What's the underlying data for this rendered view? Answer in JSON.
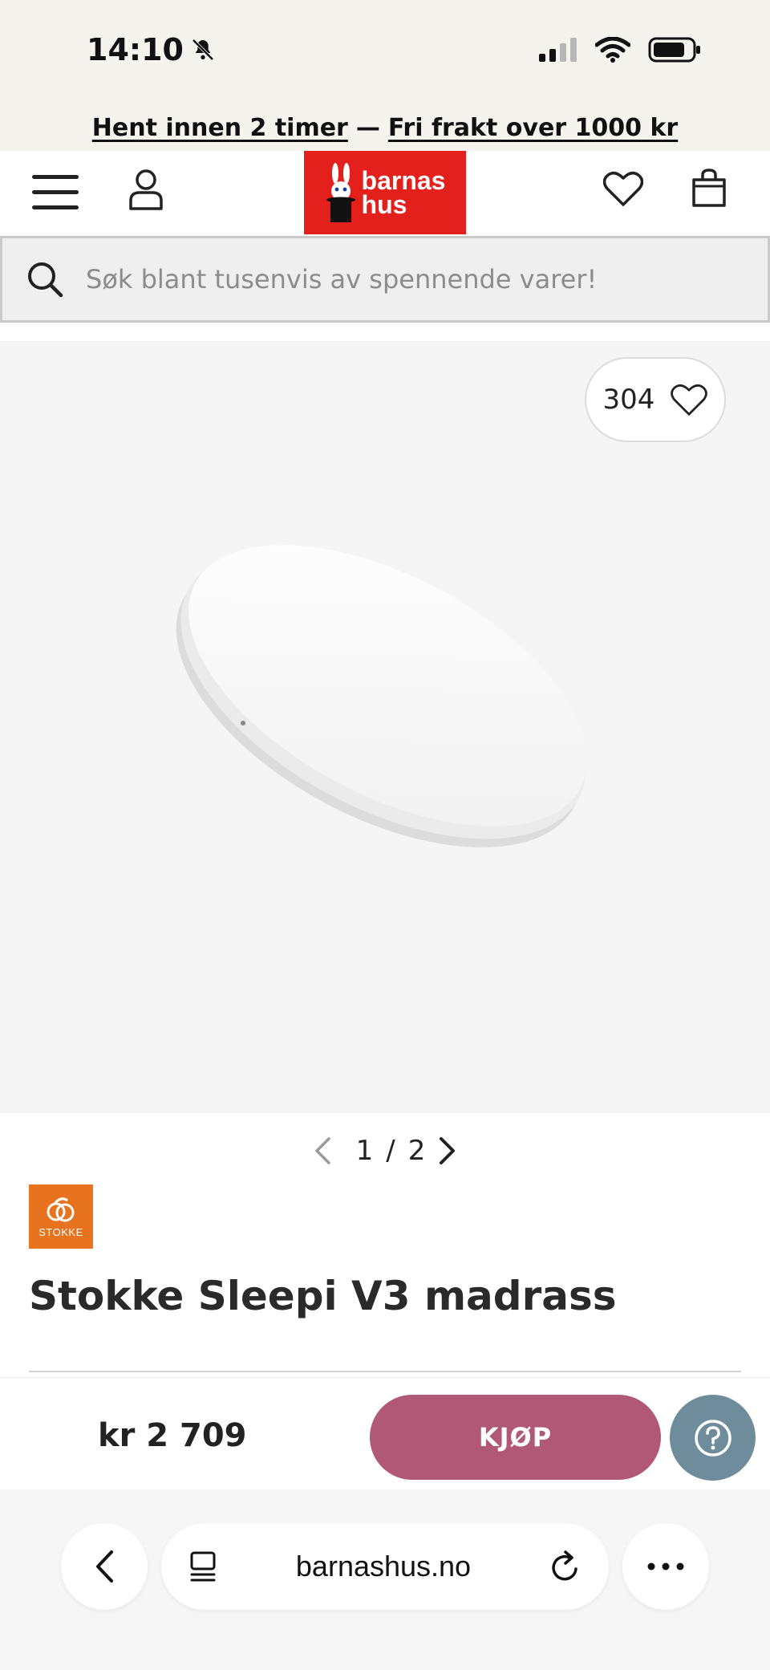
{
  "status": {
    "time": "14:10"
  },
  "promo": {
    "part1": "Hent innen 2 timer",
    "separator": "—",
    "part2": "Fri frakt over 1000 kr"
  },
  "header": {
    "logo_text_line1": "barnas",
    "logo_text_line2": "hus"
  },
  "search": {
    "placeholder": "Søk blant tusenvis av spennende varer!"
  },
  "product": {
    "like_count": "304",
    "pager": {
      "current": "1",
      "separator": "/",
      "total": "2"
    },
    "brand": "STOKKE",
    "title": "Stokke Sleepi V3 madrass",
    "price": "kr 2 709",
    "buy_label": "KJØP"
  },
  "browser": {
    "url": "barnashus.no"
  },
  "colors": {
    "logo_bg": "#e3201b",
    "buy_button": "#b05875",
    "help_button": "#6f8c9c",
    "brand_orange": "#e8731f"
  },
  "icons": [
    "bell-slash-icon",
    "signal-icon",
    "wifi-icon",
    "battery-icon",
    "menu-icon",
    "user-icon",
    "heart-icon",
    "bag-icon",
    "search-icon",
    "chevron-left-icon",
    "chevron-right-icon",
    "help-icon",
    "tabs-icon",
    "reload-icon",
    "more-icon"
  ]
}
